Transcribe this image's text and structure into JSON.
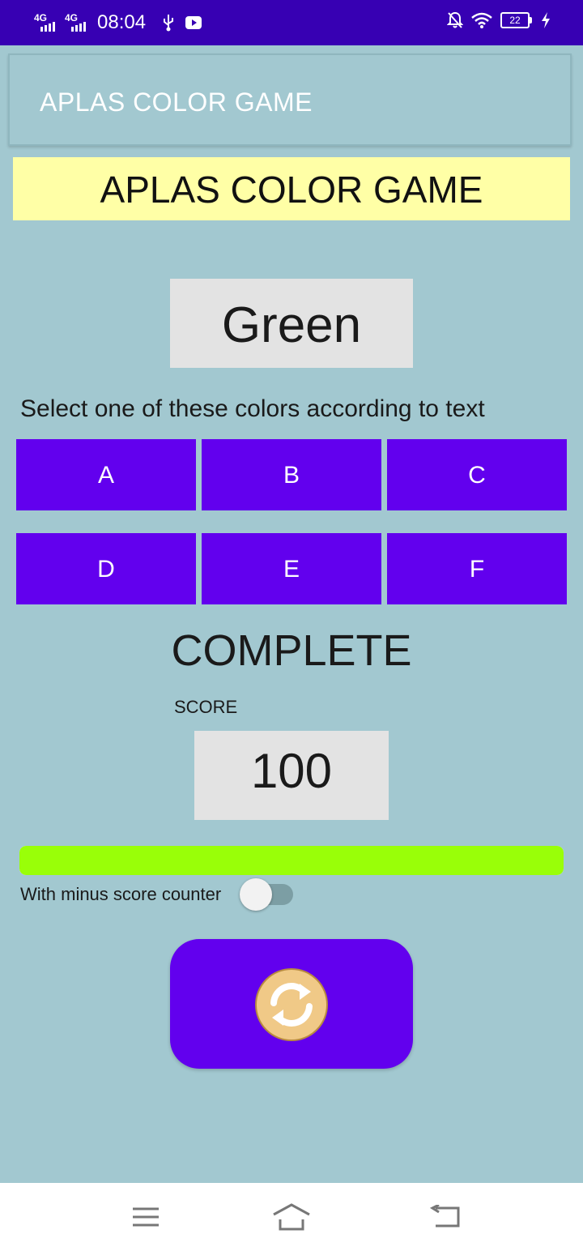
{
  "status_bar": {
    "network_1": "4G",
    "network_2": "4G",
    "time": "08:04",
    "battery": "22",
    "icons": [
      "usb-icon",
      "youtube-icon",
      "notifications-off-icon",
      "wifi-icon",
      "battery-icon",
      "charging-icon"
    ]
  },
  "app_bar": {
    "title": "APLAS COLOR GAME"
  },
  "game": {
    "banner": "APLAS COLOR GAME",
    "color_word": "Green",
    "instruction": "Select one of these colors according to text",
    "options": [
      "A",
      "B",
      "C",
      "D",
      "E",
      "F"
    ],
    "status": "COMPLETE",
    "score_label": "SCORE",
    "score": "100",
    "progress": 1.0,
    "switch_label": "With minus score counter",
    "switch_on": false
  },
  "colors": {
    "status_bar": "#3700b3",
    "background": "#a2c8d0",
    "accent": "#6200ee",
    "banner": "#ffffa6",
    "progress": "#99ff08",
    "refresh_icon": "#f0c987"
  },
  "nav_bar": {
    "icons": [
      "menu-icon",
      "home-icon",
      "back-icon"
    ]
  }
}
